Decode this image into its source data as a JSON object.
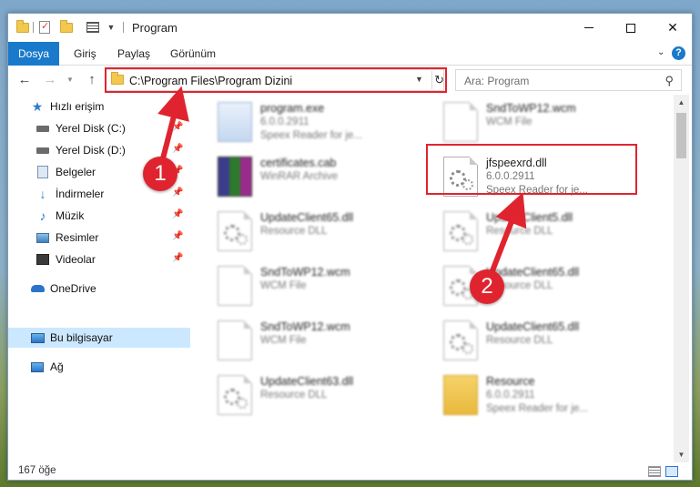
{
  "window": {
    "title": "Program",
    "controls": {
      "minimize": "minimize",
      "maximize": "maximize",
      "close": "✕"
    }
  },
  "ribbon": {
    "tabs": [
      {
        "label": "Dosya",
        "active": true
      },
      {
        "label": "Giriş"
      },
      {
        "label": "Paylaş"
      },
      {
        "label": "Görünüm"
      }
    ],
    "help": "?"
  },
  "address": {
    "path": "C:\\Program Files\\Program Dizini",
    "search_placeholder": "Ara: Program"
  },
  "nav_pane": {
    "quick_access": "Hızlı erişim",
    "items": [
      {
        "label": "Yerel Disk (C:)",
        "icon": "drive-icon",
        "pinned": true
      },
      {
        "label": "Yerel Disk (D:)",
        "icon": "drive-icon",
        "pinned": true
      },
      {
        "label": "Belgeler",
        "icon": "documents-icon",
        "pinned": true
      },
      {
        "label": "İndirmeler",
        "icon": "download-icon",
        "pinned": true
      },
      {
        "label": "Müzik",
        "icon": "music-icon",
        "pinned": true
      },
      {
        "label": "Resimler",
        "icon": "pictures-icon",
        "pinned": true
      },
      {
        "label": "Videolar",
        "icon": "video-icon",
        "pinned": true
      }
    ],
    "onedrive": "OneDrive",
    "this_pc": "Bu bilgisayar",
    "network": "Ağ"
  },
  "files": {
    "left": [
      {
        "name": "program.exe",
        "line2": "6.0.0.2911",
        "line3": "Speex Reader for je...",
        "type": "exe"
      },
      {
        "name": "certificates.cab",
        "line2": "WinRAR Archive",
        "line3": "",
        "type": "rar"
      },
      {
        "name": "UpdateClient65.dll",
        "line2": "Resource DLL",
        "line3": "",
        "type": "dll"
      },
      {
        "name": "SndToWP12.wcm",
        "line2": "WCM File",
        "line3": "",
        "type": "doc"
      },
      {
        "name": "SndToWP12.wcm",
        "line2": "WCM File",
        "line3": "",
        "type": "doc"
      },
      {
        "name": "UpdateClient63.dll",
        "line2": "Resource DLL",
        "line3": "",
        "type": "dll"
      }
    ],
    "right": [
      {
        "name": "SndToWP12.wcm",
        "line2": "WCM File",
        "line3": "",
        "type": "doc"
      },
      {
        "name": "jfspeexrd.dll",
        "line2": "6.0.0.2911",
        "line3": "Speex Reader for je...",
        "type": "dll",
        "highlighted": true
      },
      {
        "name": "UpdateClient5.dll",
        "line2": "Resource DLL",
        "line3": "",
        "type": "dll"
      },
      {
        "name": "UpdateClient65.dll",
        "line2": "Resource DLL",
        "line3": "",
        "type": "dll"
      },
      {
        "name": "UpdateClient65.dll",
        "line2": "Resource DLL",
        "line3": "",
        "type": "dll"
      },
      {
        "name": "Resource",
        "line2": "6.0.0.2911",
        "line3": "Speex Reader for je...",
        "type": "folder"
      }
    ]
  },
  "annotations": {
    "step1": "1",
    "step2": "2"
  },
  "status": {
    "item_count": "167 öğe"
  },
  "colors": {
    "accent": "#1979ca",
    "highlight": "#e0242f",
    "selection": "#cce8ff"
  }
}
